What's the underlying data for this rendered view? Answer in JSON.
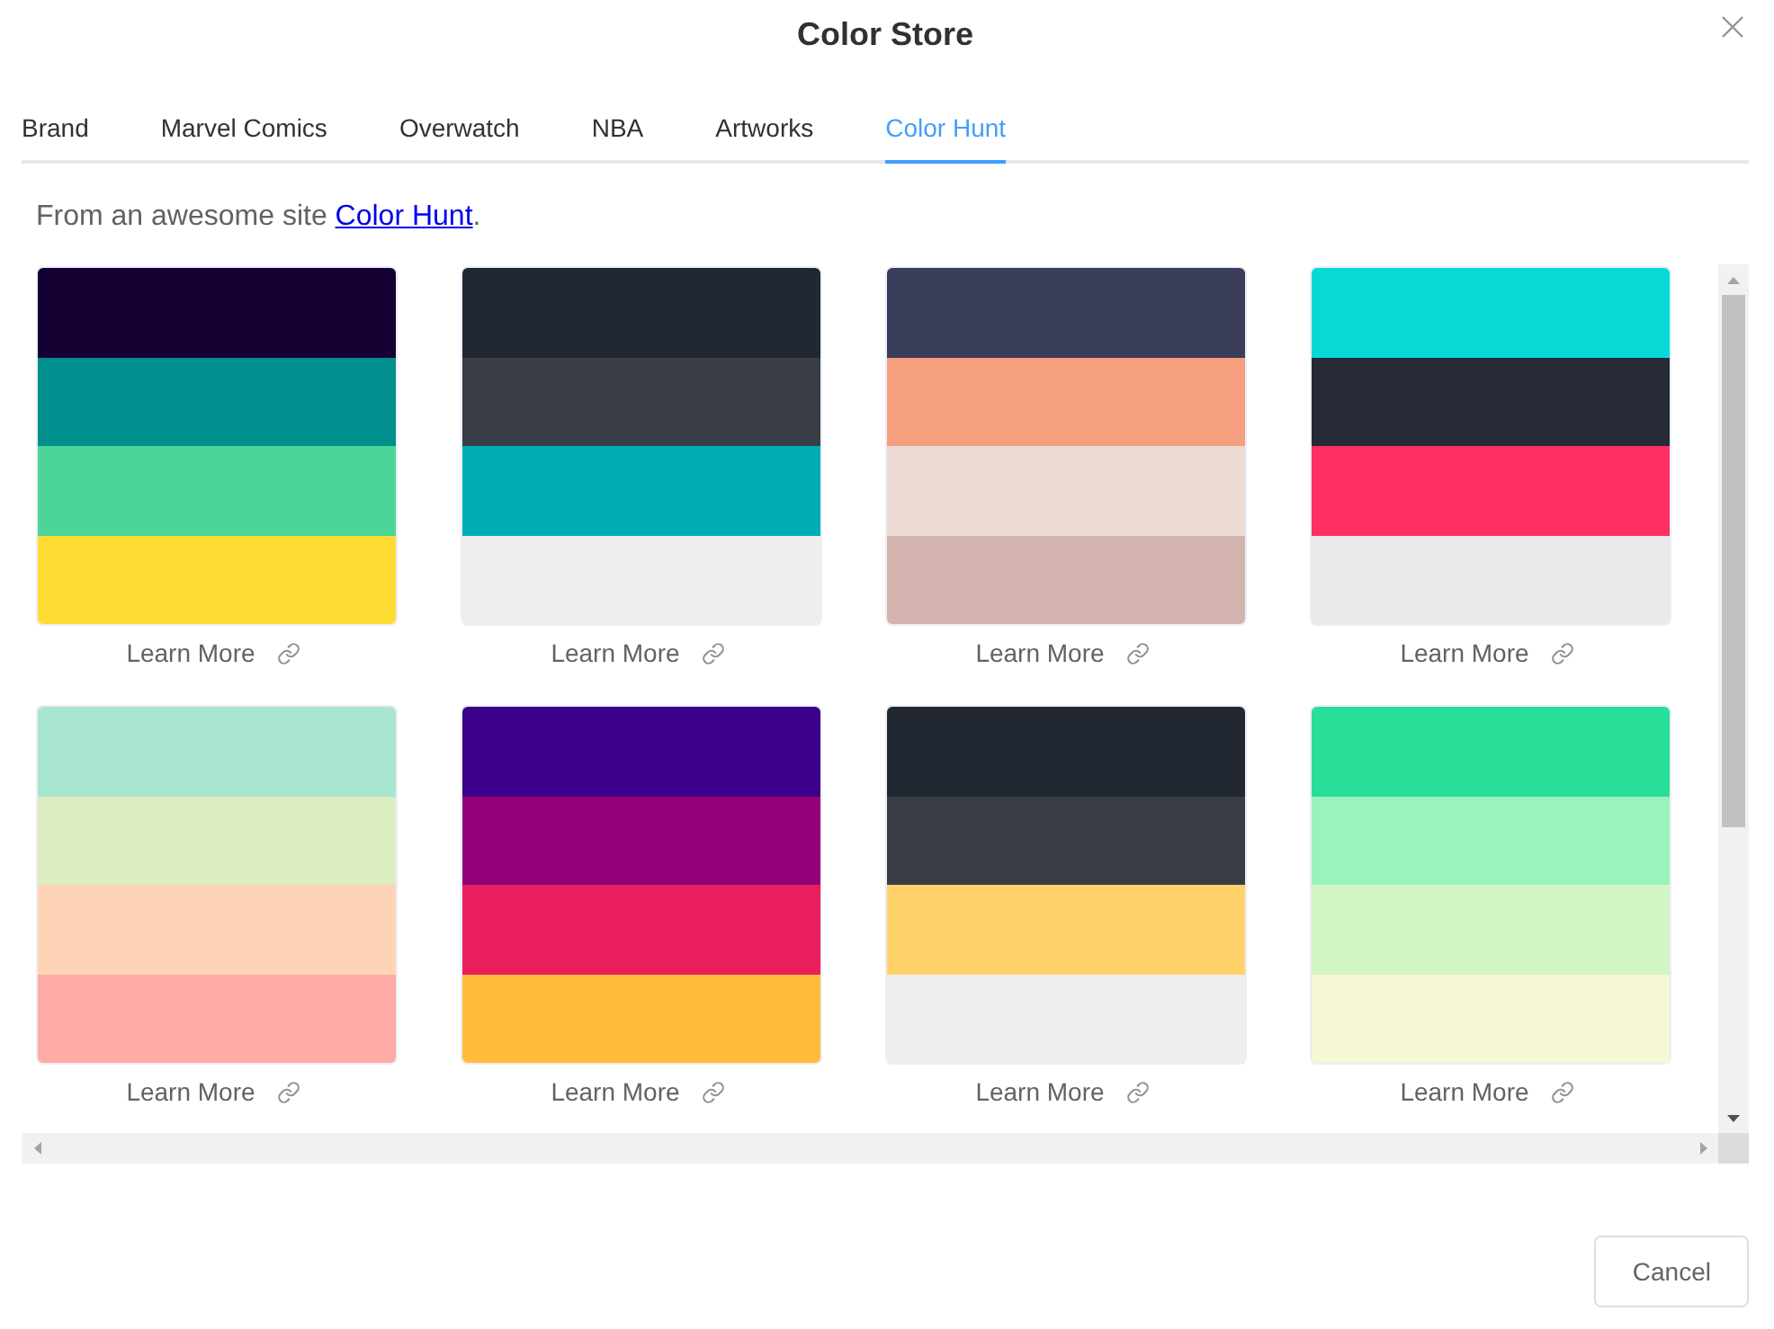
{
  "dialog": {
    "title": "Color Store"
  },
  "tabs": [
    {
      "label": "Brand",
      "selected": false
    },
    {
      "label": "Marvel Comics",
      "selected": false
    },
    {
      "label": "Overwatch",
      "selected": false
    },
    {
      "label": "NBA",
      "selected": false
    },
    {
      "label": "Artworks",
      "selected": false
    },
    {
      "label": "Color Hunt",
      "selected": true
    }
  ],
  "intro": {
    "text": "From an awesome site",
    "link": "Color Hunt",
    "end": "."
  },
  "palettes": [
    {
      "colors": [
        {
          "color": "#150033"
        },
        {
          "color": "#008f8c"
        },
        {
          "color": "#4dd599"
        },
        {
          "color": "#ffdc34"
        }
      ],
      "link": "Learn More"
    },
    {
      "colors": [
        {
          "color": "#222831"
        },
        {
          "color": "#393e46"
        },
        {
          "color": "#00adb5"
        },
        {
          "color": "#eeeeee"
        }
      ],
      "link": "Learn More"
    },
    {
      "colors": [
        {
          "color": "#3b3e5b"
        },
        {
          "color": "#f59f7f"
        },
        {
          "color": "#ecdad3"
        },
        {
          "color": "#d3b4af"
        }
      ],
      "link": "Learn More"
    },
    {
      "colors": [
        {
          "color": "#08d9d6"
        },
        {
          "color": "#252a34"
        },
        {
          "color": "#ff2e63"
        },
        {
          "color": "#eaeaea"
        }
      ],
      "link": "Learn More"
    },
    {
      "colors": [
        {
          "color": "#a8e6cf"
        },
        {
          "color": "#dcedc1"
        },
        {
          "color": "#ffd3b6"
        },
        {
          "color": "#ffaaa5"
        }
      ],
      "link": "Learn More"
    },
    {
      "colors": [
        {
          "color": "#3c008a"
        },
        {
          "color": "#940077"
        },
        {
          "color": "#e81e5d"
        },
        {
          "color": "#ffbc3b"
        }
      ],
      "link": "Learn More"
    },
    {
      "colors": [
        {
          "color": "#222831"
        },
        {
          "color": "#393e46"
        },
        {
          "color": "#ffd369"
        },
        {
          "color": "#eeeeee"
        }
      ],
      "link": "Learn More"
    },
    {
      "colors": [
        {
          "color": "#28df99"
        },
        {
          "color": "#99f3bd"
        },
        {
          "color": "#d2f6c5"
        },
        {
          "color": "#f6f7d4"
        }
      ],
      "link": "Learn More"
    }
  ],
  "footer": {
    "cancel": "Cancel"
  }
}
